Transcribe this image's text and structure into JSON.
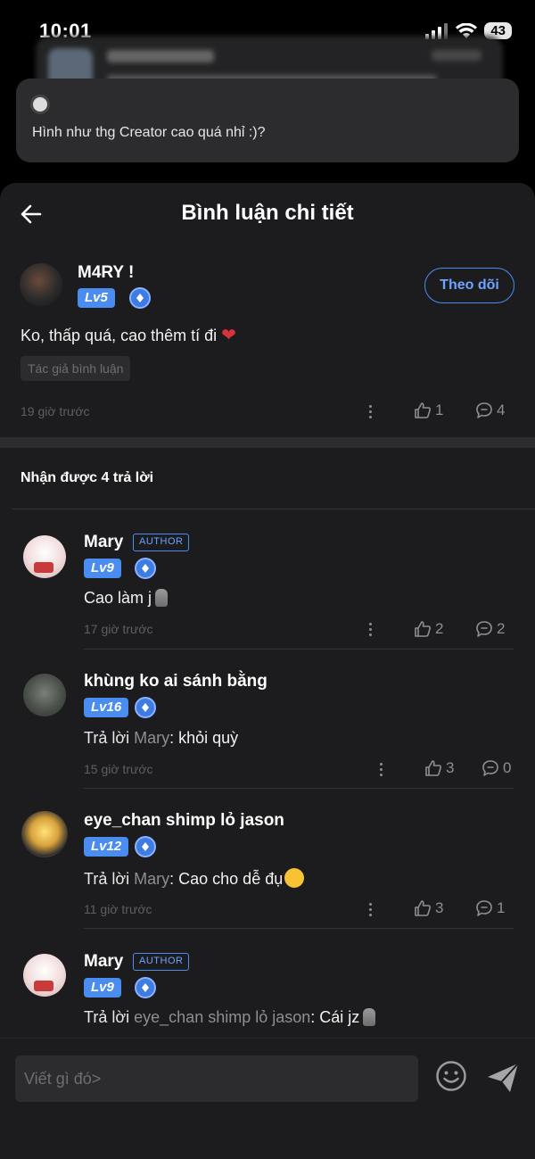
{
  "status_bar": {
    "time": "10:01",
    "battery": "43"
  },
  "prev_comment": {
    "text": "Hình như thg Creator cao quá nhỉ :)?"
  },
  "header": {
    "title": "Bình luận chi tiết"
  },
  "main_comment": {
    "username": "M4RY !",
    "level": "Lv5",
    "follow_label": "Theo dõi",
    "text": "Ko, thấp quá, cao thêm tí đi",
    "tag": "Tác giả bình luận",
    "time": "19 giờ trước",
    "likes": "1",
    "replies": "4"
  },
  "replies_header": "Nhận được 4 trả lời",
  "replies": [
    {
      "username": "Mary",
      "author_tag": "AUTHOR",
      "level": "Lv9",
      "text": "Cao làm j",
      "reply_prefix": "",
      "reply_to": "",
      "time": "17 giờ trước",
      "likes": "2",
      "replies": "2"
    },
    {
      "username": "khùng ko ai sánh bằng",
      "author_tag": "",
      "level": "Lv16",
      "text": ": khỏi quỳ",
      "reply_prefix": "Trả lời ",
      "reply_to": "Mary",
      "time": "15 giờ trước",
      "likes": "3",
      "replies": "0"
    },
    {
      "username": "eye_chan shimp lỏ jason",
      "author_tag": "",
      "level": "Lv12",
      "text": ": Cao cho dễ đụ",
      "reply_prefix": "Trả lời ",
      "reply_to": "Mary",
      "time": "11 giờ trước",
      "likes": "3",
      "replies": "1"
    },
    {
      "username": "Mary",
      "author_tag": "AUTHOR",
      "level": "Lv9",
      "text": ": Cái jz",
      "reply_prefix": "Trả lời ",
      "reply_to": "eye_chan shimp lỏ jason",
      "time": "",
      "likes": "",
      "replies": ""
    }
  ],
  "composer": {
    "placeholder": "Viết gì đó>"
  }
}
